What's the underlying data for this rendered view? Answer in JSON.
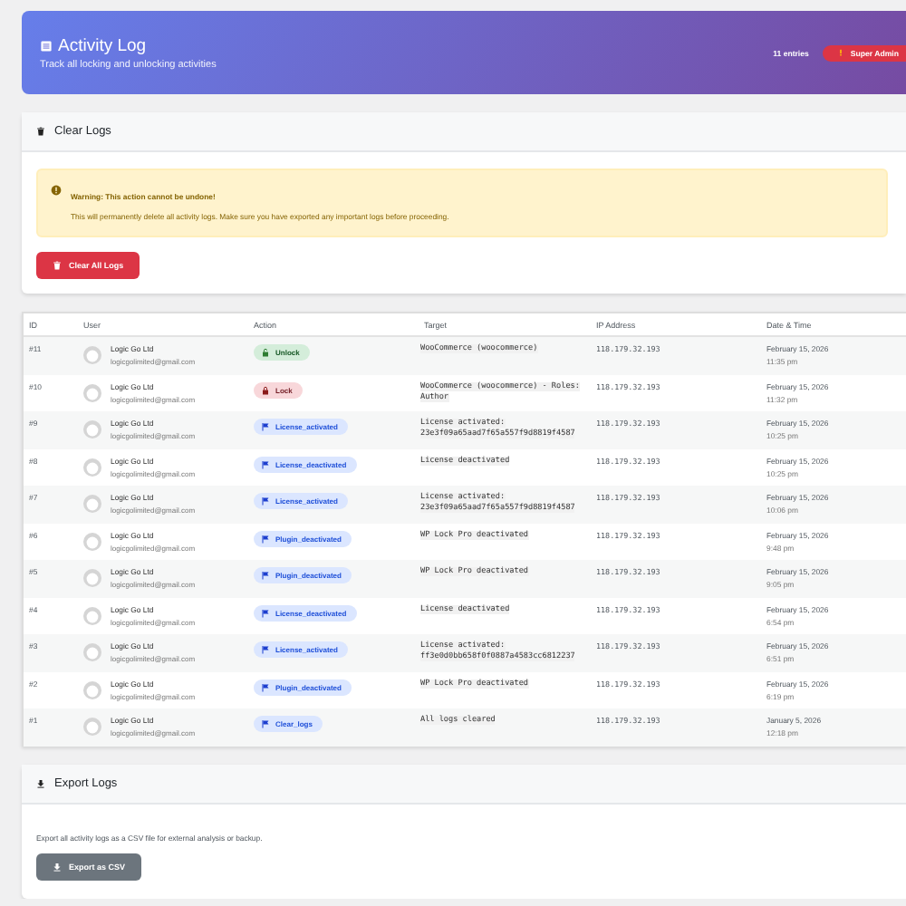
{
  "header": {
    "title": "Activity Log",
    "subtitle": "Track all locking and unlocking activities",
    "entries": "11 entries",
    "role_badge": "Super Admin"
  },
  "clear_section": {
    "title": "Clear Logs",
    "warning_title": "Warning: This action cannot be undone!",
    "warning_text": "This will permanently delete all activity logs. Make sure you have exported any important logs before proceeding.",
    "button": "Clear All Logs"
  },
  "table": {
    "columns": [
      "ID",
      "User",
      "Action",
      "Target",
      "IP Address",
      "Date & Time"
    ],
    "rows": [
      {
        "id": "#11",
        "user": "Logic Go Ltd",
        "email": "logicgolimited@gmail.com",
        "action": "Unlock",
        "kind": "unlock",
        "target": [
          "WooCommerce (woocommerce)"
        ],
        "ip": "118.179.32.193",
        "date": "February 15, 2026",
        "time": "11:35 pm"
      },
      {
        "id": "#10",
        "user": "Logic Go Ltd",
        "email": "logicgolimited@gmail.com",
        "action": "Lock",
        "kind": "lock",
        "target": [
          "WooCommerce (woocommerce) - Roles:",
          "Author"
        ],
        "ip": "118.179.32.193",
        "date": "February 15, 2026",
        "time": "11:32 pm"
      },
      {
        "id": "#9",
        "user": "Logic Go Ltd",
        "email": "logicgolimited@gmail.com",
        "action": "License_activated",
        "kind": "event",
        "target": [
          "License activated:",
          "23e3f09a65aad7f65a557f9d8819f4587"
        ],
        "ip": "118.179.32.193",
        "date": "February 15, 2026",
        "time": "10:25 pm"
      },
      {
        "id": "#8",
        "user": "Logic Go Ltd",
        "email": "logicgolimited@gmail.com",
        "action": "License_deactivated",
        "kind": "event",
        "target": [
          "License deactivated"
        ],
        "ip": "118.179.32.193",
        "date": "February 15, 2026",
        "time": "10:25 pm"
      },
      {
        "id": "#7",
        "user": "Logic Go Ltd",
        "email": "logicgolimited@gmail.com",
        "action": "License_activated",
        "kind": "event",
        "target": [
          "License activated:",
          "23e3f09a65aad7f65a557f9d8819f4587"
        ],
        "ip": "118.179.32.193",
        "date": "February 15, 2026",
        "time": "10:06 pm"
      },
      {
        "id": "#6",
        "user": "Logic Go Ltd",
        "email": "logicgolimited@gmail.com",
        "action": "Plugin_deactivated",
        "kind": "event",
        "target": [
          "WP Lock Pro deactivated"
        ],
        "ip": "118.179.32.193",
        "date": "February 15, 2026",
        "time": "9:48 pm"
      },
      {
        "id": "#5",
        "user": "Logic Go Ltd",
        "email": "logicgolimited@gmail.com",
        "action": "Plugin_deactivated",
        "kind": "event",
        "target": [
          "WP Lock Pro deactivated"
        ],
        "ip": "118.179.32.193",
        "date": "February 15, 2026",
        "time": "9:05 pm"
      },
      {
        "id": "#4",
        "user": "Logic Go Ltd",
        "email": "logicgolimited@gmail.com",
        "action": "License_deactivated",
        "kind": "event",
        "target": [
          "License deactivated"
        ],
        "ip": "118.179.32.193",
        "date": "February 15, 2026",
        "time": "6:54 pm"
      },
      {
        "id": "#3",
        "user": "Logic Go Ltd",
        "email": "logicgolimited@gmail.com",
        "action": "License_activated",
        "kind": "event",
        "target": [
          "License activated:",
          "ff3e0d0bb658f0f0887a4583cc6812237"
        ],
        "ip": "118.179.32.193",
        "date": "February 15, 2026",
        "time": "6:51 pm"
      },
      {
        "id": "#2",
        "user": "Logic Go Ltd",
        "email": "logicgolimited@gmail.com",
        "action": "Plugin_deactivated",
        "kind": "event",
        "target": [
          "WP Lock Pro deactivated"
        ],
        "ip": "118.179.32.193",
        "date": "February 15, 2026",
        "time": "6:19 pm"
      },
      {
        "id": "#1",
        "user": "Logic Go Ltd",
        "email": "logicgolimited@gmail.com",
        "action": "Clear_logs",
        "kind": "event",
        "target": [
          "All logs cleared"
        ],
        "ip": "118.179.32.193",
        "date": "January 5, 2026",
        "time": "12:18 pm"
      }
    ]
  },
  "export_section": {
    "title": "Export Logs",
    "text": "Export all activity logs as a CSV file for external analysis or backup.",
    "button": "Export as CSV"
  }
}
